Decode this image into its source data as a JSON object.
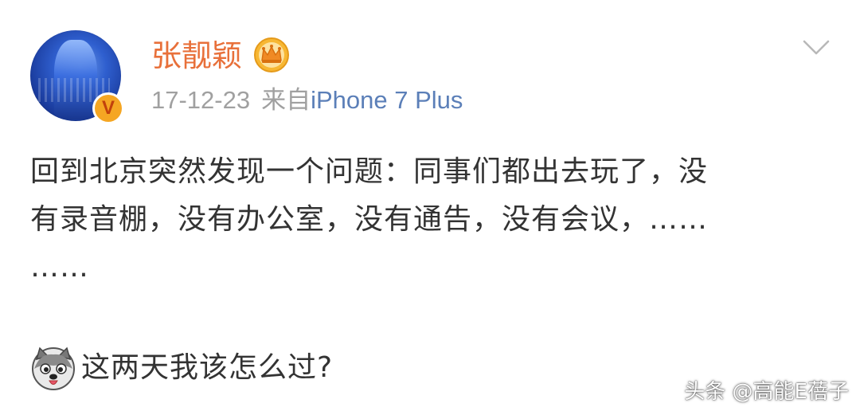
{
  "post": {
    "author": {
      "name": "张靓颖",
      "avatar_icon": "user-avatar",
      "verified_badge": "V",
      "member_icon": "crown-icon"
    },
    "meta": {
      "date": "17-12-23",
      "source_prefix": "来自",
      "device": "iPhone 7 Plus"
    },
    "body_text": "回到北京突然发现一个问题：同事们都出去玩了，没\n有录音棚，没有办公室，没有通告，没有会议，……\n……",
    "emoji_icon": "husky-dog-emoji",
    "emoji_text": "这两天我该怎么过?",
    "menu_icon": "chevron-down-icon"
  },
  "watermark": "头条 @高能E蓓子",
  "colors": {
    "username": "#e8703a",
    "meta": "#a0a0a0",
    "device_link": "#5b7fb8",
    "body_text": "#333333",
    "badge": "#f5a623"
  }
}
